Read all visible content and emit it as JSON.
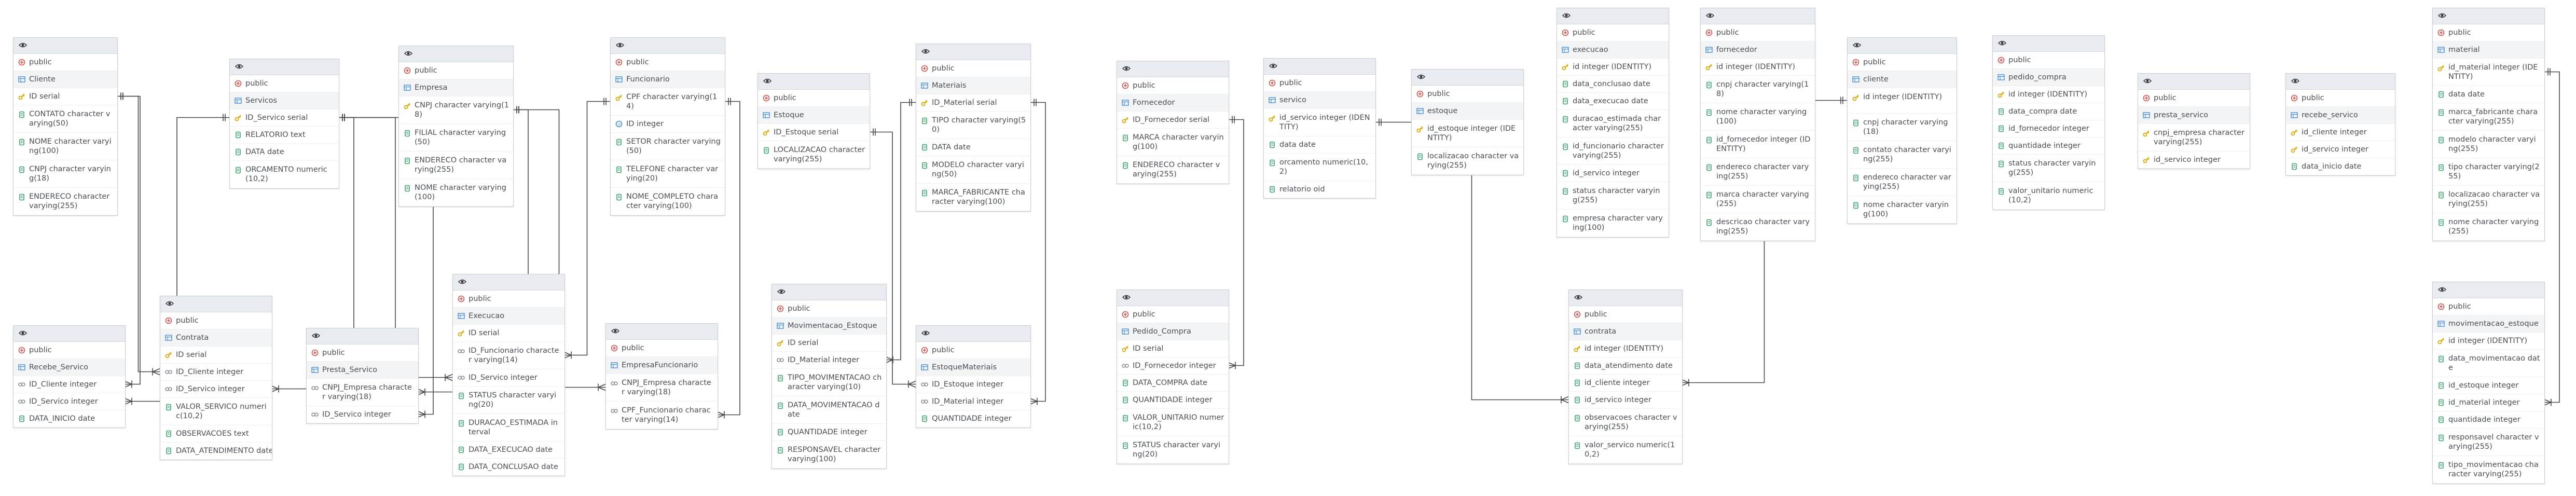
{
  "tables": [
    {
      "id": "cliente1",
      "schema": "public",
      "name": "Cliente",
      "columns": [
        {
          "k": "pk",
          "t": "ID serial"
        },
        {
          "k": "col",
          "t": "CONTATO character varying(50)"
        },
        {
          "k": "col",
          "t": "NOME character varying(100)"
        },
        {
          "k": "col",
          "t": "CNPJ character varying(18)"
        },
        {
          "k": "col",
          "t": "ENDERECO character varying(255)"
        }
      ]
    },
    {
      "id": "servicos1",
      "schema": "public",
      "name": "Servicos",
      "columns": [
        {
          "k": "pk",
          "t": "ID_Servico serial"
        },
        {
          "k": "col",
          "t": "RELATORIO text"
        },
        {
          "k": "col",
          "t": "DATA date"
        },
        {
          "k": "col",
          "t": "ORCAMENTO numeric(10,2)"
        }
      ]
    },
    {
      "id": "empresa1",
      "schema": "public",
      "name": "Empresa",
      "columns": [
        {
          "k": "pk",
          "t": "CNPJ character varying(18)"
        },
        {
          "k": "col",
          "t": "FILIAL character varying(50)"
        },
        {
          "k": "col",
          "t": "ENDERECO character varying(255)"
        },
        {
          "k": "col",
          "t": "NOME character varying(100)"
        }
      ]
    },
    {
      "id": "funcionario1",
      "schema": "public",
      "name": "Funcionario",
      "columns": [
        {
          "k": "pk",
          "t": "CPF character varying(14)"
        },
        {
          "k": "uk",
          "t": "ID integer"
        },
        {
          "k": "col",
          "t": "SETOR character varying(50)"
        },
        {
          "k": "col",
          "t": "TELEFONE character varying(20)"
        },
        {
          "k": "col",
          "t": "NOME_COMPLETO character varying(100)"
        }
      ]
    },
    {
      "id": "estoque1",
      "schema": "public",
      "name": "Estoque",
      "columns": [
        {
          "k": "pk",
          "t": "ID_Estoque serial"
        },
        {
          "k": "col",
          "t": "LOCALIZACAO character varying(255)"
        }
      ]
    },
    {
      "id": "materiais1",
      "schema": "public",
      "name": "Materiais",
      "columns": [
        {
          "k": "pk",
          "t": "ID_Material serial"
        },
        {
          "k": "col",
          "t": "TIPO character varying(50)"
        },
        {
          "k": "col",
          "t": "DATA date"
        },
        {
          "k": "col",
          "t": "MODELO character varying(50)"
        },
        {
          "k": "col",
          "t": "MARCA_FABRICANTE character varying(100)"
        }
      ]
    },
    {
      "id": "fornecedor1",
      "schema": "public",
      "name": "Fornecedor",
      "columns": [
        {
          "k": "pk",
          "t": "ID_Fornecedor serial"
        },
        {
          "k": "col",
          "t": "MARCA character varying(100)"
        },
        {
          "k": "col",
          "t": "ENDERECO character varying(255)"
        }
      ]
    },
    {
      "id": "servico2",
      "schema": "public",
      "name": "servico",
      "columns": [
        {
          "k": "pk",
          "t": "id_servico integer (IDENTITY)"
        },
        {
          "k": "col",
          "t": "data date"
        },
        {
          "k": "col",
          "t": "orcamento numeric(10,2)"
        },
        {
          "k": "col",
          "t": "relatorio oid"
        }
      ]
    },
    {
      "id": "estoque2",
      "schema": "public",
      "name": "estoque",
      "columns": [
        {
          "k": "pk",
          "t": "id_estoque integer (IDENTITY)"
        },
        {
          "k": "col",
          "t": "localizacao character varying(255)"
        }
      ]
    },
    {
      "id": "execucao2",
      "schema": "public",
      "name": "execucao",
      "columns": [
        {
          "k": "pk",
          "t": "id integer (IDENTITY)"
        },
        {
          "k": "col",
          "t": "data_conclusao date"
        },
        {
          "k": "col",
          "t": "data_execucao date"
        },
        {
          "k": "col",
          "t": "duracao_estimada character varying(255)"
        },
        {
          "k": "col",
          "t": "id_funcionario character varying(255)"
        },
        {
          "k": "col",
          "t": "id_servico integer"
        },
        {
          "k": "col",
          "t": "status character varying(255)"
        },
        {
          "k": "col",
          "t": "empresa character varying(100)"
        }
      ]
    },
    {
      "id": "fornecedor2",
      "schema": "public",
      "name": "fornecedor",
      "columns": [
        {
          "k": "pk",
          "t": "id integer (IDENTITY)"
        },
        {
          "k": "col",
          "t": "cnpj character varying(18)"
        },
        {
          "k": "col",
          "t": "nome character varying(100)"
        },
        {
          "k": "col",
          "t": "id_fornecedor integer (IDENTITY)"
        },
        {
          "k": "col",
          "t": "endereco character varying(255)"
        },
        {
          "k": "col",
          "t": "marca character varying(255)"
        },
        {
          "k": "col",
          "t": "descricao character varying(255)"
        }
      ]
    },
    {
      "id": "cliente2",
      "schema": "public",
      "name": "cliente",
      "columns": [
        {
          "k": "pk",
          "t": "id integer (IDENTITY)"
        },
        {
          "k": "col",
          "t": "cnpj character varying(18)"
        },
        {
          "k": "col",
          "t": "contato character varying(255)"
        },
        {
          "k": "col",
          "t": "endereco character varying(255)"
        },
        {
          "k": "col",
          "t": "nome character varying(100)"
        }
      ]
    },
    {
      "id": "pedido_compra2",
      "schema": "public",
      "name": "pedido_compra",
      "columns": [
        {
          "k": "pk",
          "t": "id integer (IDENTITY)"
        },
        {
          "k": "col",
          "t": "data_compra date"
        },
        {
          "k": "col",
          "t": "id_fornecedor integer"
        },
        {
          "k": "col",
          "t": "quantidade integer"
        },
        {
          "k": "col",
          "t": "status character varying(255)"
        },
        {
          "k": "col",
          "t": "valor_unitario numeric(10,2)"
        }
      ]
    },
    {
      "id": "presta_servico2",
      "schema": "public",
      "name": "presta_servico",
      "columns": [
        {
          "k": "pk",
          "t": "cnpj_empresa character varying(255)"
        },
        {
          "k": "pk",
          "t": "id_servico integer"
        }
      ]
    },
    {
      "id": "recebe_servico2",
      "schema": "public",
      "name": "recebe_servico",
      "columns": [
        {
          "k": "pk",
          "t": "id_cliente integer"
        },
        {
          "k": "pk",
          "t": "id_servico integer"
        },
        {
          "k": "col",
          "t": "data_inicio date"
        }
      ]
    },
    {
      "id": "material2",
      "schema": "public",
      "name": "material",
      "columns": [
        {
          "k": "pk",
          "t": "id_material integer (IDENTITY)"
        },
        {
          "k": "col",
          "t": "data date"
        },
        {
          "k": "col",
          "t": "marca_fabricante character varying(255)"
        },
        {
          "k": "col",
          "t": "modelo character varying(255)"
        },
        {
          "k": "col",
          "t": "tipo character varying(255)"
        },
        {
          "k": "col",
          "t": "localizacao character varying(255)"
        },
        {
          "k": "col",
          "t": "nome character varying(255)"
        }
      ]
    },
    {
      "id": "recebe_servico1",
      "schema": "public",
      "name": "Recebe_Servico",
      "columns": [
        {
          "k": "fk",
          "t": "ID_Cliente integer"
        },
        {
          "k": "fk",
          "t": "ID_Servico integer"
        },
        {
          "k": "col",
          "t": "DATA_INICIO date"
        }
      ]
    },
    {
      "id": "contrata1",
      "schema": "public",
      "name": "Contrata",
      "columns": [
        {
          "k": "pk",
          "t": "ID serial"
        },
        {
          "k": "fk",
          "t": "ID_Cliente integer"
        },
        {
          "k": "fk",
          "t": "ID_Servico integer"
        },
        {
          "k": "col",
          "t": "VALOR_SERVICO numeric(10,2)"
        },
        {
          "k": "col",
          "t": "OBSERVACOES text"
        },
        {
          "k": "col",
          "t": "DATA_ATENDIMENTO date"
        }
      ]
    },
    {
      "id": "presta_servico1",
      "schema": "public",
      "name": "Presta_Servico",
      "columns": [
        {
          "k": "fk",
          "t": "CNPJ_Empresa character varying(18)"
        },
        {
          "k": "fk",
          "t": "ID_Servico integer"
        }
      ]
    },
    {
      "id": "execucao1",
      "schema": "public",
      "name": "Execucao",
      "columns": [
        {
          "k": "pk",
          "t": "ID serial"
        },
        {
          "k": "fk",
          "t": "ID_Funcionario character varying(14)"
        },
        {
          "k": "fk",
          "t": "ID_Servico integer"
        },
        {
          "k": "col",
          "t": "STATUS character varying(20)"
        },
        {
          "k": "col",
          "t": "DURACAO_ESTIMADA interval"
        },
        {
          "k": "col",
          "t": "DATA_EXECUCAO date"
        },
        {
          "k": "col",
          "t": "DATA_CONCLUSAO date"
        }
      ]
    },
    {
      "id": "empresafunc1",
      "schema": "public",
      "name": "EmpresaFuncionario",
      "columns": [
        {
          "k": "fk",
          "t": "CNPJ_Empresa character varying(18)"
        },
        {
          "k": "fk",
          "t": "CPF_Funcionario character varying(14)"
        }
      ]
    },
    {
      "id": "movest1",
      "schema": "public",
      "name": "Movimentacao_Estoque",
      "columns": [
        {
          "k": "pk",
          "t": "ID serial"
        },
        {
          "k": "fk",
          "t": "ID_Material integer"
        },
        {
          "k": "col",
          "t": "TIPO_MOVIMENTACAO character varying(10)"
        },
        {
          "k": "col",
          "t": "DATA_MOVIMENTACAO date"
        },
        {
          "k": "col",
          "t": "QUANTIDADE integer"
        },
        {
          "k": "col",
          "t": "RESPONSAVEL character varying(100)"
        }
      ]
    },
    {
      "id": "estoquemat1",
      "schema": "public",
      "name": "EstoqueMateriais",
      "columns": [
        {
          "k": "fk",
          "t": "ID_Estoque integer"
        },
        {
          "k": "fk",
          "t": "ID_Material integer"
        },
        {
          "k": "col",
          "t": "QUANTIDADE integer"
        }
      ]
    },
    {
      "id": "pedido_compra1",
      "schema": "public",
      "name": "Pedido_Compra",
      "columns": [
        {
          "k": "pk",
          "t": "ID serial"
        },
        {
          "k": "fk",
          "t": "ID_Fornecedor integer"
        },
        {
          "k": "col",
          "t": "DATA_COMPRA date"
        },
        {
          "k": "col",
          "t": "QUANTIDADE integer"
        },
        {
          "k": "col",
          "t": "VALOR_UNITARIO numeric(10,2)"
        },
        {
          "k": "col",
          "t": "STATUS character varying(20)"
        }
      ]
    },
    {
      "id": "contrata2",
      "schema": "public",
      "name": "contrata",
      "columns": [
        {
          "k": "pk",
          "t": "id integer (IDENTITY)"
        },
        {
          "k": "col",
          "t": "data_atendimento date"
        },
        {
          "k": "col",
          "t": "id_cliente integer"
        },
        {
          "k": "col",
          "t": "id_servico integer"
        },
        {
          "k": "col",
          "t": "observacoes character varying(255)"
        },
        {
          "k": "col",
          "t": "valor_servico numeric(10,2)"
        }
      ]
    },
    {
      "id": "movest2",
      "schema": "public",
      "name": "movimentacao_estoque",
      "columns": [
        {
          "k": "pk",
          "t": "id integer (IDENTITY)"
        },
        {
          "k": "col",
          "t": "data_movimentacao date"
        },
        {
          "k": "col",
          "t": "id_estoque integer"
        },
        {
          "k": "col",
          "t": "id_material integer"
        },
        {
          "k": "col",
          "t": "quantidade integer"
        },
        {
          "k": "col",
          "t": "responsavel character varying(255)"
        },
        {
          "k": "col",
          "t": "tipo_movimentacao character varying(255)"
        }
      ]
    }
  ],
  "icon_names": {
    "pk": "key-icon",
    "fk": "link-icon",
    "uk": "unique-icon",
    "col": "column-icon",
    "eye": "eye-icon",
    "schema": "schema-icon",
    "table": "table-icon"
  },
  "colors": {
    "header": "#e8ebf0",
    "border": "#c9ccd1",
    "line": "#4a4a4a",
    "key": "#e0a800",
    "column": "#3aa76d",
    "fk": "#8a8f99",
    "schema": "#d9534f",
    "table": "#4a90d9"
  }
}
